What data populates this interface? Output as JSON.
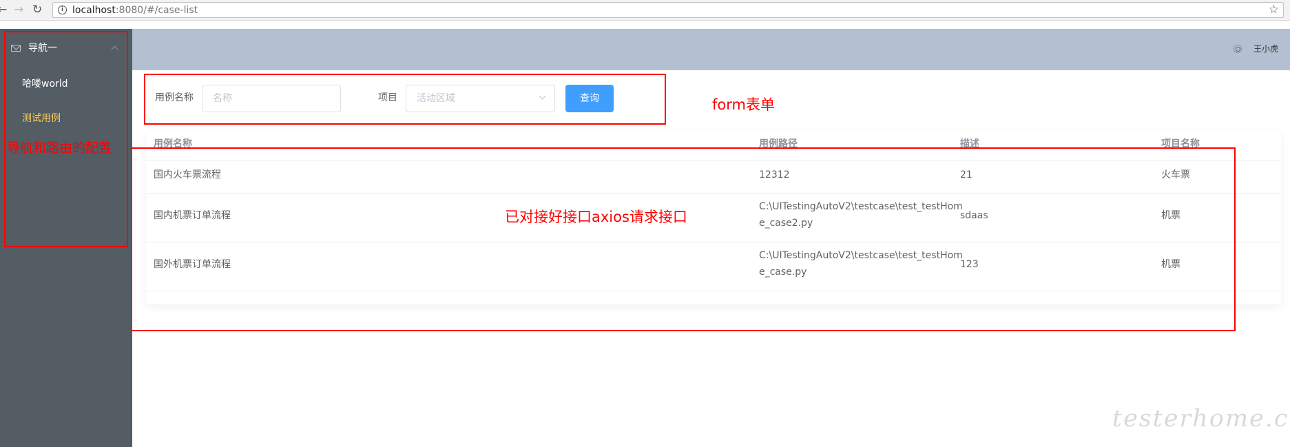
{
  "browser": {
    "back_icon": "back-arrow-icon",
    "forward_icon": "forward-arrow-icon",
    "reload_icon": "reload-icon",
    "url_host": "localhost",
    "url_rest": ":8080/#/case-list"
  },
  "sidebar": {
    "background": "#545c64",
    "submenu_title": "导航一",
    "submenu_icon": "mail-icon",
    "items": [
      {
        "label": "哈喽world",
        "active": false
      },
      {
        "label": "测试用例",
        "active": true
      }
    ]
  },
  "header": {
    "background": "#b3c0d1",
    "settings_icon": "gear-icon",
    "username": "王小虎"
  },
  "form": {
    "case_name_label": "用例名称",
    "case_name_placeholder": "名称",
    "project_label": "项目",
    "project_placeholder": "活动区域",
    "search_button": "查询",
    "button_color": "#409eff"
  },
  "table": {
    "columns": [
      "用例名称",
      "用例路径",
      "描述",
      "项目名称"
    ],
    "rows": [
      {
        "name": "国内火车票流程",
        "path_line1": "12312",
        "path_line2": "",
        "desc": "21",
        "project": "火车票"
      },
      {
        "name": "国内机票订单流程",
        "path_line1": "C:\\UITestingAutoV2\\testcase\\test_testHom",
        "path_line2": "e_case2.py",
        "desc": "sdaas",
        "project": "机票"
      },
      {
        "name": "国外机票订单流程",
        "path_line1": "C:\\UITestingAutoV2\\testcase\\test_testHom",
        "path_line2": "e_case.py",
        "desc": "123",
        "project": "机票"
      }
    ]
  },
  "annotations": {
    "color": "#ff0000",
    "form_note": "form表单",
    "sidebar_note": "导航和路由的配置",
    "table_note": "已对接好接口axios请求接口"
  },
  "watermark": "testerhome.com"
}
